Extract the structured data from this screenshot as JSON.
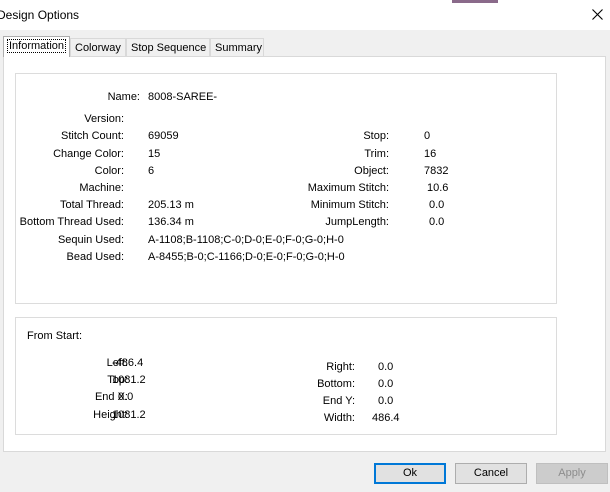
{
  "window": {
    "title": "Design Options"
  },
  "tabs": [
    "Information",
    "Colorway",
    "Stop Sequence",
    "Summary"
  ],
  "info": {
    "name_label": "Name:",
    "name": "8008-SAREE-",
    "version_label": "Version:",
    "version": "",
    "stitch_count_label": "Stitch Count:",
    "stitch_count": "69059",
    "change_color_label": "Change Color:",
    "change_color": "15",
    "color_label": "Color:",
    "color": "6",
    "machine_label": "Machine:",
    "machine": "",
    "total_thread_label": "Total Thread:",
    "total_thread": "205.13 m",
    "bottom_thread_label": "Bottom Thread Used:",
    "bottom_thread": "136.34 m",
    "sequin_label": "Sequin Used:",
    "sequin": "A-1108;B-1108;C-0;D-0;E-0;F-0;G-0;H-0",
    "bead_label": "Bead Used:",
    "bead": "A-8455;B-0;C-1166;D-0;E-0;F-0;G-0;H-0",
    "stop_label": "Stop:",
    "stop": "0",
    "trim_label": "Trim:",
    "trim": "16",
    "object_label": "Object:",
    "object": "7832",
    "max_stitch_label": "Maximum Stitch:",
    "max_stitch": "10.6",
    "min_stitch_label": "Minimum Stitch:",
    "min_stitch": "0.0",
    "jump_label": "JumpLength:",
    "jump": "0.0"
  },
  "from_start": {
    "heading": "From Start:",
    "left_label": "Left:",
    "left": "-486.4",
    "top_label": "Top:",
    "top": "1081.2",
    "endx_label": "End X:",
    "endx": "0.0",
    "height_label": "Height:",
    "height": "1081.2",
    "right_label": "Right:",
    "right": "0.0",
    "bottom_label": "Bottom:",
    "bottom": "0.0",
    "endy_label": "End Y:",
    "endy": "0.0",
    "width_label": "Width:",
    "width": "486.4"
  },
  "buttons": {
    "ok": "Ok",
    "cancel": "Cancel",
    "apply": "Apply"
  }
}
